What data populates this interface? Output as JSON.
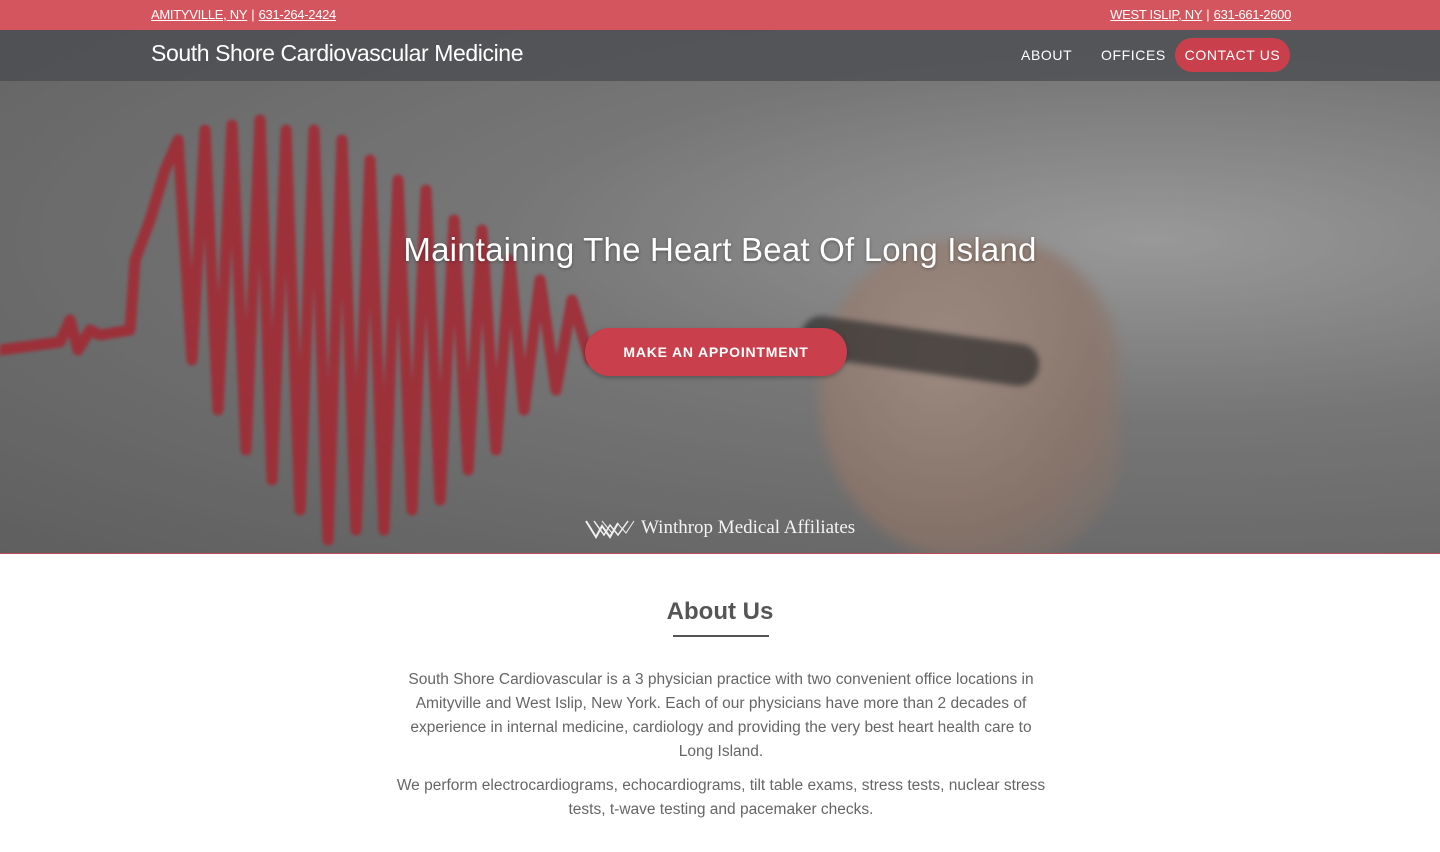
{
  "topbar": {
    "left_city": "AMITYVILLE, NY",
    "left_phone": "631-264-2424",
    "right_city": "WEST ISLIP, NY",
    "right_phone": "631-661-2600",
    "separator": "|"
  },
  "nav": {
    "brand": "South Shore Cardiovascular Medicine",
    "links": [
      "ABOUT",
      "OFFICES"
    ],
    "contact": "CONTACT US"
  },
  "hero": {
    "headline": "Maintaining The Heart Beat Of Long Island",
    "cta": "MAKE AN APPOINTMENT",
    "affiliate": "Winthrop Medical Affiliates"
  },
  "about": {
    "title": "About Us",
    "paragraphs": [
      "South Shore Cardiovascular is a 3 physician practice with two convenient office locations in Amityville and West Islip, New York. Each of our physicians have more than 2 decades of experience in internal medicine, cardiology and providing the very best heart health care to Long Island.",
      "We perform electrocardiograms, echocardiograms, tilt table exams, stress tests, nuclear stress tests, t-wave testing and pacemaker checks."
    ]
  },
  "colors": {
    "accent": "#d5555e",
    "button": "#c9404c",
    "nav_bg": "#464a4e"
  }
}
